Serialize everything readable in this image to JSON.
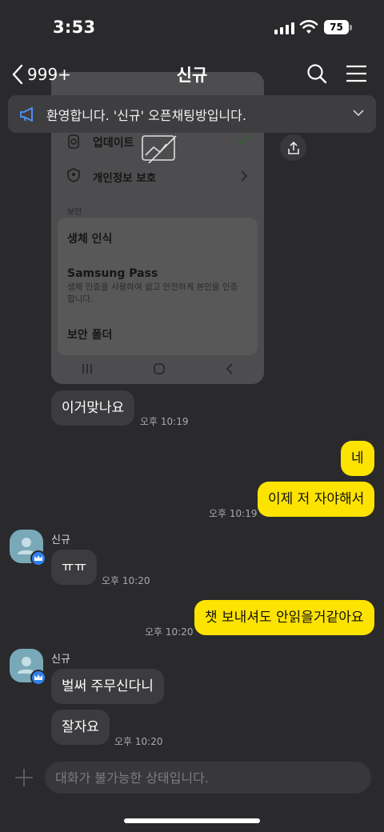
{
  "status_bar": {
    "time": "3:53",
    "battery": "75"
  },
  "nav": {
    "back_count": "999+",
    "title": "신규"
  },
  "notice": {
    "text": "환영합니다. '신규' 오픈채팅방입니다."
  },
  "shared_image": {
    "rows": [
      "업데이트",
      "개인정보 보호"
    ],
    "section": "보안",
    "items": [
      "생체 인식",
      "Samsung Pass",
      "보안 폴더"
    ],
    "samsung_pass_desc": "생체 인증을 사용하여 쉽고 안전하게 본인을 인증합니다."
  },
  "messages": [
    {
      "text": "이거맞나요",
      "time": "오후 10:19"
    },
    {
      "text": "네"
    },
    {
      "text": "이제 저 자야해서",
      "time": "오후 10:19"
    },
    {
      "sender": "신규",
      "text": "ㅠㅠ",
      "time": "오후 10:20"
    },
    {
      "text": "챗 보내셔도 안읽을거같아요",
      "time": "오후 10:20"
    },
    {
      "sender": "신규",
      "text": "벌써 주무신다니"
    },
    {
      "text": "잘자요",
      "time": "오후 10:20"
    }
  ],
  "input": {
    "placeholder": "대화가 불가능한 상태입니다."
  },
  "colors": {
    "background": "#2a2a2d",
    "my_bubble": "#fde300",
    "other_bubble": "#3c3c3f",
    "notice_icon": "#4d8ef0"
  },
  "icons": [
    "back-chevron-icon",
    "search-icon",
    "menu-icon",
    "megaphone-icon",
    "chevron-down-icon",
    "share-icon",
    "plus-icon",
    "crown-icon"
  ]
}
